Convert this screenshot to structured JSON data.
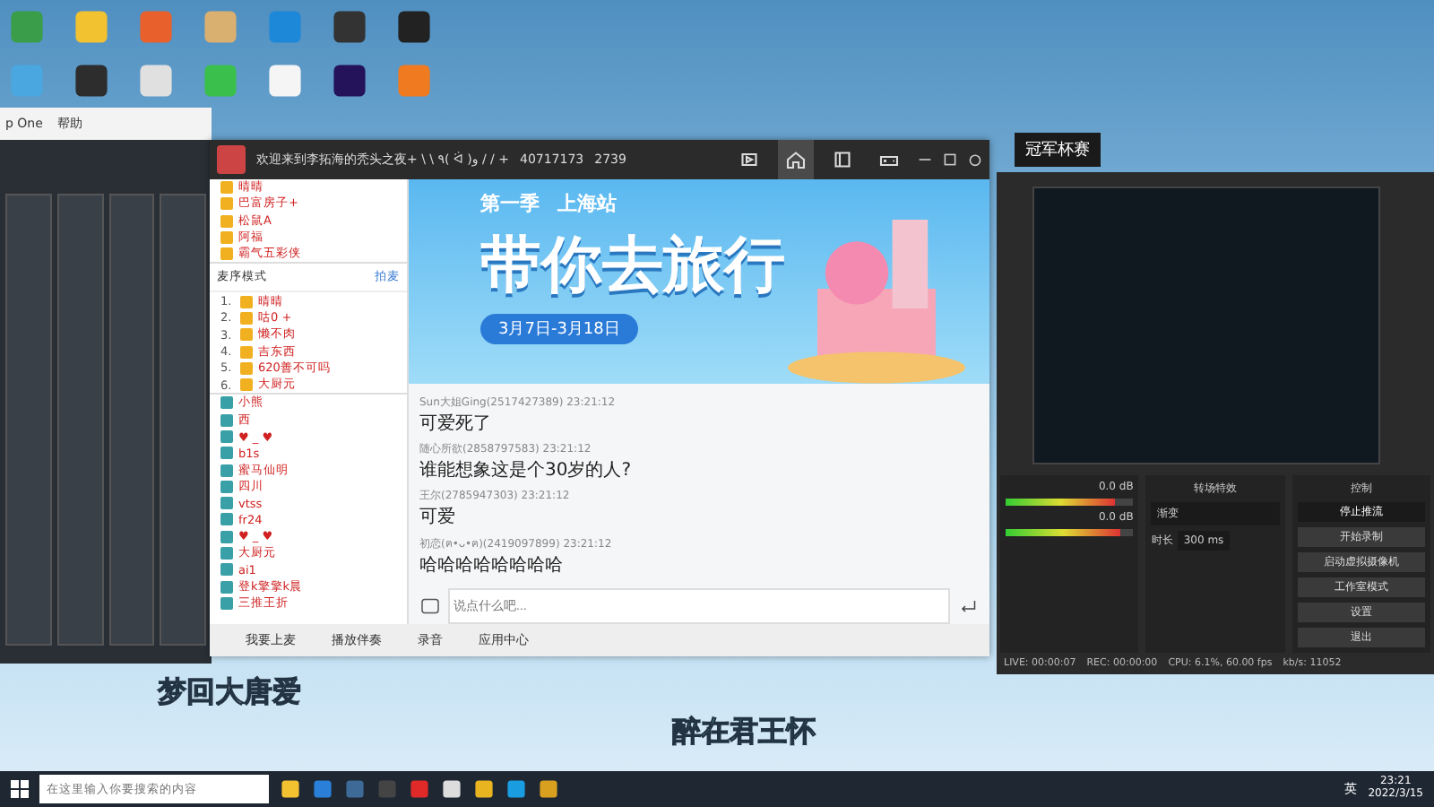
{
  "daw_window": {
    "title": "p One",
    "menu": [
      "帮助"
    ]
  },
  "chat_window": {
    "title": "欢迎来到李拓海的秃头之夜+ \\ \\ ٩( ᐛ )و / / +",
    "room_id": "40717173",
    "online": "2739",
    "tabs": [
      {
        "kind": "video",
        "selected": false
      },
      {
        "kind": "home",
        "selected": true
      },
      {
        "kind": "book",
        "selected": false
      },
      {
        "kind": "game",
        "selected": false
      }
    ],
    "vip_list": [
      {
        "name": "晴晴"
      },
      {
        "name": "巴富房子+"
      },
      {
        "name": "松鼠A"
      },
      {
        "name": "阿福"
      },
      {
        "name": "霸气五彩侠"
      }
    ],
    "mode": "麦序模式",
    "mode_action": "拍麦",
    "queue": [
      {
        "rank": "1.",
        "name": "晴晴"
      },
      {
        "rank": "2.",
        "name": "咕0 +"
      },
      {
        "rank": "3.",
        "name": "懒不肉"
      },
      {
        "rank": "4.",
        "name": "吉东西"
      },
      {
        "rank": "5.",
        "name": "620善不可吗"
      },
      {
        "rank": "6.",
        "name": "大厨元"
      }
    ],
    "members": [
      {
        "name": "小熊"
      },
      {
        "name": "西"
      },
      {
        "name": "♥ _ ♥"
      },
      {
        "name": "b1s"
      },
      {
        "name": "蜜马仙明"
      },
      {
        "name": "四川"
      },
      {
        "name": "vtss"
      },
      {
        "name": "fr24"
      },
      {
        "name": "♥ _ ♥"
      },
      {
        "name": "大厨元"
      },
      {
        "name": "ai1"
      },
      {
        "name": "登k擎擎k晨"
      },
      {
        "name": "三推王折"
      }
    ],
    "banner": {
      "season": "第一季",
      "location": "上海站",
      "headline": "带你去旅行",
      "dates": "3月7日-3月18日"
    },
    "messages": [
      {
        "sender": "Sun大姐Ging(2517427389)",
        "time": "23:21:12",
        "text": "可爱死了"
      },
      {
        "sender": "随心所欲(2858797583)",
        "time": "23:21:12",
        "text": "谁能想象这是个30岁的人?"
      },
      {
        "sender": "王尔(2785947303)",
        "time": "23:21:12",
        "text": "可爱"
      },
      {
        "sender": "初恋(ฅ•ᴗ•ฅ)(2419097899)",
        "time": "23:21:12",
        "text": "哈哈哈哈哈哈哈哈"
      }
    ],
    "input_placeholder": "说点什么吧...",
    "bottom_bar": [
      "我要上麦",
      "播放伴奏",
      "录音",
      "应用中心"
    ]
  },
  "obs_window": {
    "title": "冠军杯赛",
    "meters": [
      {
        "reading": "0.0 dB",
        "level": 0.85
      },
      {
        "reading": "0.0 dB",
        "level": 0.9
      }
    ],
    "transition_title": "转场特效",
    "transition": "渐变",
    "duration_label": "时长",
    "duration": "300 ms",
    "controls_title": "控制",
    "controls": [
      {
        "label": "停止推流",
        "selected": true
      },
      {
        "label": "开始录制",
        "selected": false
      },
      {
        "label": "启动虚拟摄像机",
        "selected": false
      },
      {
        "label": "工作室模式",
        "selected": false
      },
      {
        "label": "设置",
        "selected": false
      },
      {
        "label": "退出",
        "selected": false
      }
    ],
    "status": [
      "LIVE: 00:00:07",
      "REC: 00:00:00",
      "CPU: 6.1%, 60.00 fps",
      "kb/s: 11052"
    ]
  },
  "lyrics": [
    "梦回大唐爱",
    "醉在君王怀"
  ],
  "taskbar": {
    "search_placeholder": "在这里输入你要搜索的内容",
    "ime": "英",
    "time": "23:21",
    "date": "2022/3/15"
  }
}
